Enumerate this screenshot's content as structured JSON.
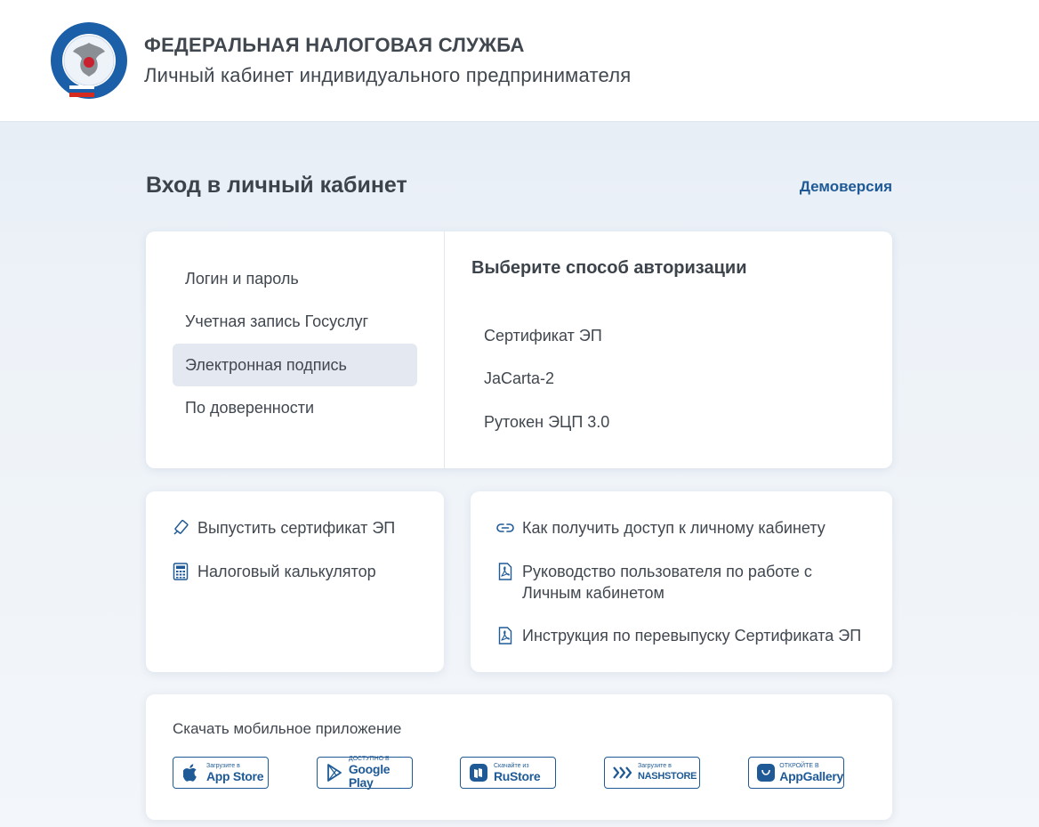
{
  "header": {
    "org_name": "ФЕДЕРАЛЬНАЯ НАЛОГОВАЯ СЛУЖБА",
    "subtitle": "Личный кабинет индивидуального предпринимателя",
    "logo_icon": "fns-emblem-icon",
    "logo_ring_text": "ФЕДЕРАЛЬНАЯ НАЛОГОВАЯ СЛУЖБА"
  },
  "page": {
    "title": "Вход в личный кабинет",
    "demo_link": "Демоверсия"
  },
  "auth": {
    "methods": [
      {
        "label": "Логин и пароль",
        "active": false
      },
      {
        "label": "Учетная запись Госуслуг",
        "active": false
      },
      {
        "label": "Электронная подпись",
        "active": true
      },
      {
        "label": "По доверенности",
        "active": false
      }
    ],
    "heading": "Выберите способ авторизации",
    "options": [
      "Сертификат ЭП",
      "JaCarta-2",
      "Рутокен ЭЦП 3.0"
    ]
  },
  "tools": [
    {
      "label": "Выпустить сертификат ЭП",
      "icon": "usb-token-icon"
    },
    {
      "label": "Налоговый калькулятор",
      "icon": "calculator-icon"
    }
  ],
  "links": [
    {
      "label": "Как получить доступ к личному кабинету",
      "icon": "link-icon"
    },
    {
      "label": "Руководство пользователя по работе с",
      "label2": "Личным кабинетом",
      "icon": "pdf-icon"
    },
    {
      "label": "Инструкция по перевыпуску Сертификата ЭП",
      "icon": "pdf-icon"
    }
  ],
  "apps": {
    "title": "Скачать мобильное приложение",
    "stores": [
      {
        "small": "Загрузите в",
        "big": "App Store",
        "icon": "apple-icon"
      },
      {
        "small": "ДОСТУПНО В",
        "big": "Google Play",
        "icon": "google-play-icon"
      },
      {
        "small": "Скачайте из",
        "big": "RuStore",
        "icon": "rustore-icon"
      },
      {
        "small": "Загрузите в",
        "big": "NASHSTORE",
        "icon": "nashstore-icon"
      },
      {
        "small": "ОТКРОЙТЕ В",
        "big": "AppGallery",
        "icon": "appgallery-icon"
      }
    ]
  },
  "colors": {
    "accent": "#1f5a96",
    "text": "#40474f",
    "active_bg": "#e4e9f1"
  }
}
